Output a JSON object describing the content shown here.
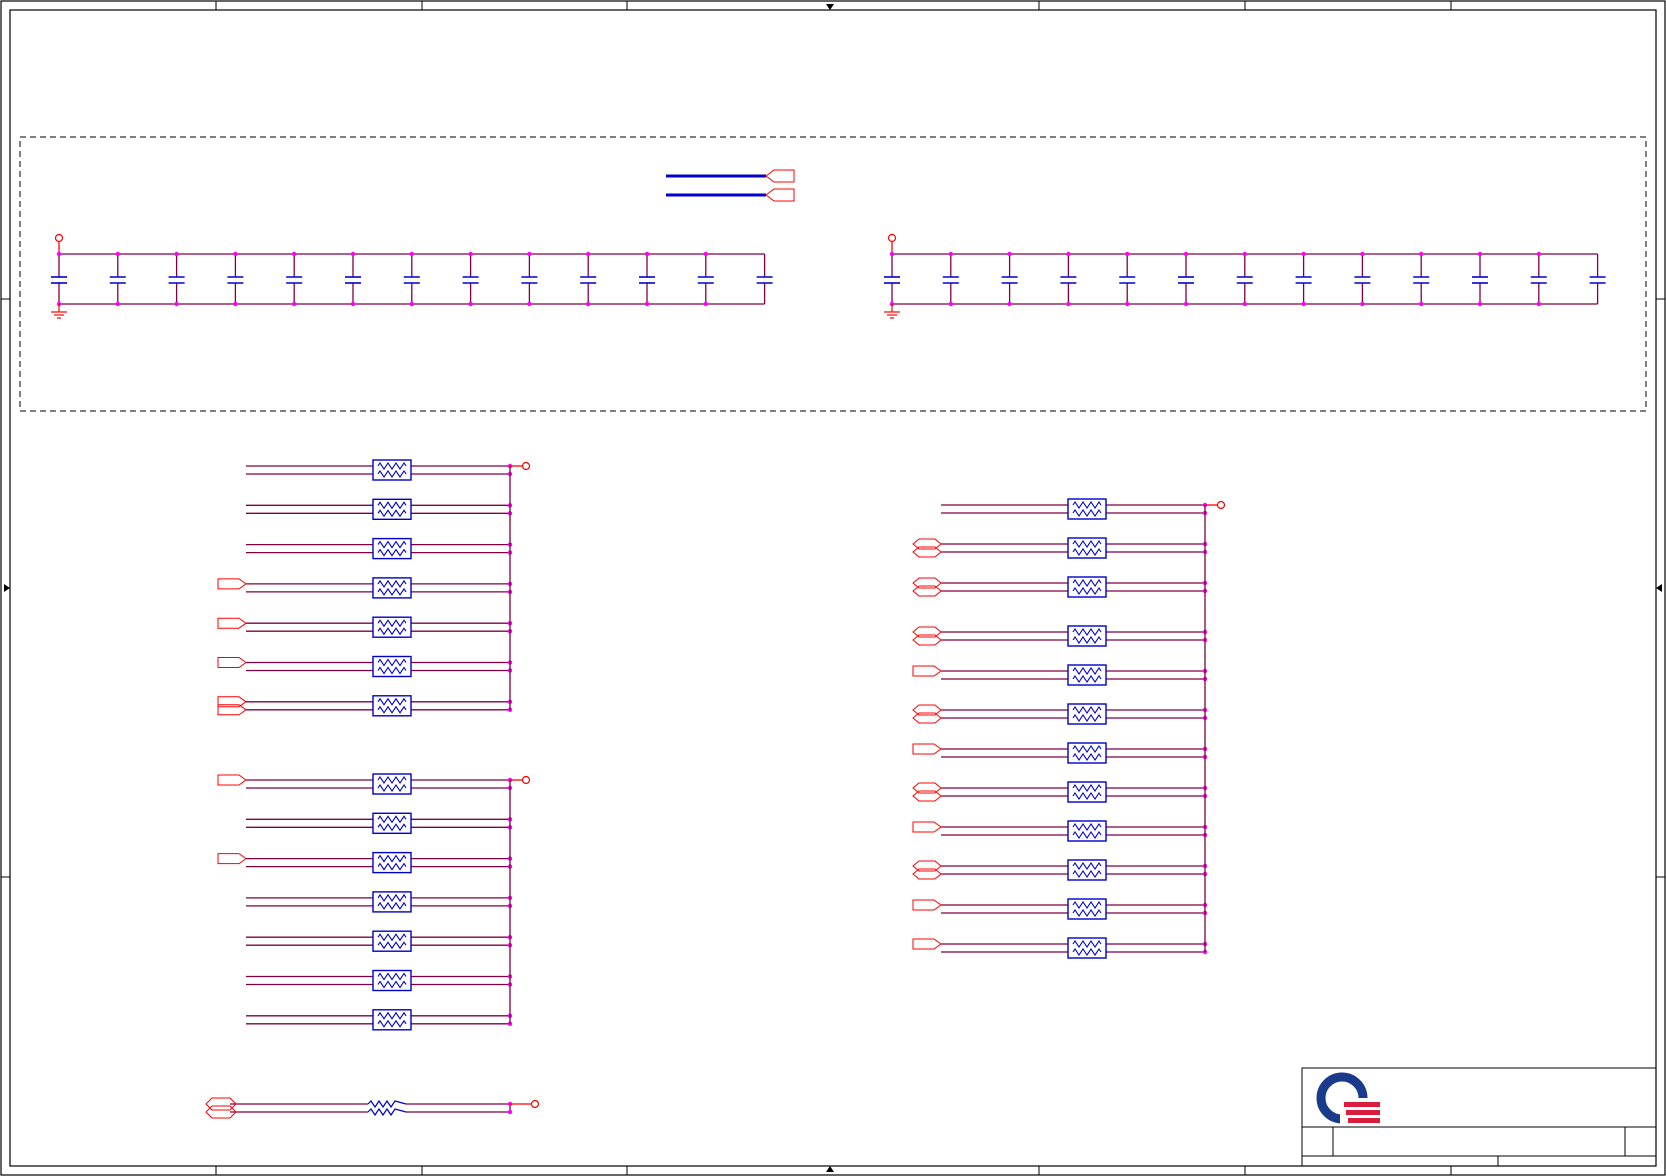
{
  "colors": {
    "border": "#000000",
    "wire": "#800040",
    "net": "#ff0000",
    "component": "#0000cc",
    "junction": "#ff00ff",
    "logo_blue": "#1a3a8c",
    "logo_red": "#d81e3c"
  },
  "icons": {
    "logo": "company-logo-icon",
    "resistor": "resistor-array-icon",
    "capacitor": "capacitor-icon",
    "ground": "ground-icon",
    "power": "power-port-icon",
    "port": "port-connector-icon"
  },
  "schematic": {
    "cap_rows": [
      {
        "name": "cap-row-left",
        "capacitors": 13
      },
      {
        "name": "cap-row-right",
        "capacitors": 13
      }
    ],
    "resistor_groups": [
      {
        "name": "resistor-group-top-left",
        "resistors": 7
      },
      {
        "name": "resistor-group-bottom-left",
        "resistors": 7
      },
      {
        "name": "resistor-group-right",
        "resistors": 12
      },
      {
        "name": "single-resistor",
        "resistors": 1
      }
    ]
  }
}
